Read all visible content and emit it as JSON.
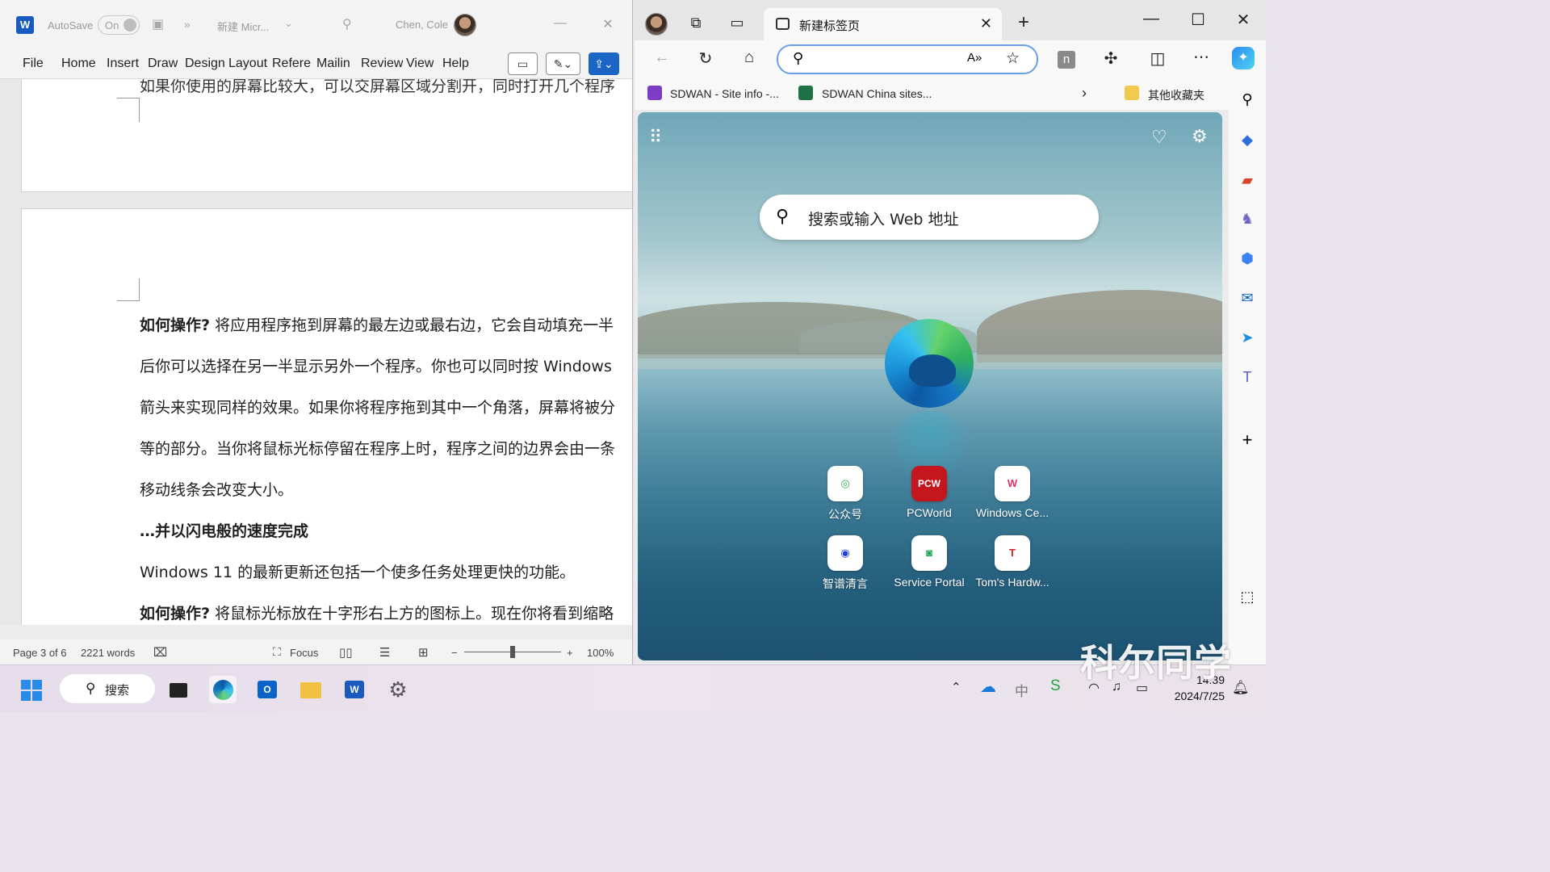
{
  "word": {
    "autosave_label": "AutoSave",
    "autosave_state": "On",
    "doc_name": "新建 Micr...",
    "user_name": "Chen, Cole",
    "ribbon_tabs": [
      "File",
      "Home",
      "Insert",
      "Draw",
      "Design",
      "Layout",
      "Referer",
      "Mailin",
      "Review",
      "View",
      "Help"
    ],
    "top_line": "如果你使用的屏幕比较大，可以交屏幕区域分割开，同时打开几个程序",
    "paragraphs": [
      {
        "bold": "如何操作?",
        "text": " 将应用程序拖到屏幕的最左边或最右边，它会自动填充一半"
      },
      {
        "bold": "",
        "text": "后你可以选择在另一半显示另外一个程序。你也可以同时按 Windows"
      },
      {
        "bold": "",
        "text": "箭头来实现同样的效果。如果你将程序拖到其中一个角落，屏幕将被分"
      },
      {
        "bold": "",
        "text": "等的部分。当你将鼠标光标停留在程序上时，程序之间的边界会由一条"
      },
      {
        "bold": "",
        "text": "移动线条会改变大小。"
      },
      {
        "bold": "…并以闪电般的速度完成",
        "text": ""
      },
      {
        "bold": "",
        "text": "Windows 11 的最新更新还包括一个使多任务处理更快的功能。"
      },
      {
        "bold": "如何操作?",
        "text": " 将鼠标光标放在十字形右上方的图标上。现在你将看到缩略"
      }
    ],
    "status": {
      "page": "Page 3 of 6",
      "words": "2221 words",
      "focus": "Focus",
      "zoom": "100%"
    }
  },
  "edge": {
    "tab_title": "新建标签页",
    "favorites": [
      {
        "label": "SDWAN - Site info -..."
      },
      {
        "label": "SDWAN China sites..."
      }
    ],
    "other_favorites": "其他收藏夹",
    "ntp_search_placeholder": "搜索或输入 Web 地址",
    "tiles": [
      {
        "label": "公众号",
        "glyph": "◎",
        "color": "#2ab24a"
      },
      {
        "label": "PCWorld",
        "glyph": "PCW",
        "color": "#c4161c"
      },
      {
        "label": "Windows Ce...",
        "glyph": "W",
        "color": "#e0306a"
      },
      {
        "label": "智谱清言",
        "glyph": "◉",
        "color": "#1c3fd6"
      },
      {
        "label": "Service Portal",
        "glyph": "◙",
        "color": "#16a34a"
      },
      {
        "label": "Tom's Hardw...",
        "glyph": "T",
        "color": "#d1242a"
      }
    ]
  },
  "taskbar": {
    "search_label": "搜索",
    "ime": "中",
    "time": "14:39",
    "date": "2024/7/25"
  },
  "watermark": "科尔同学"
}
